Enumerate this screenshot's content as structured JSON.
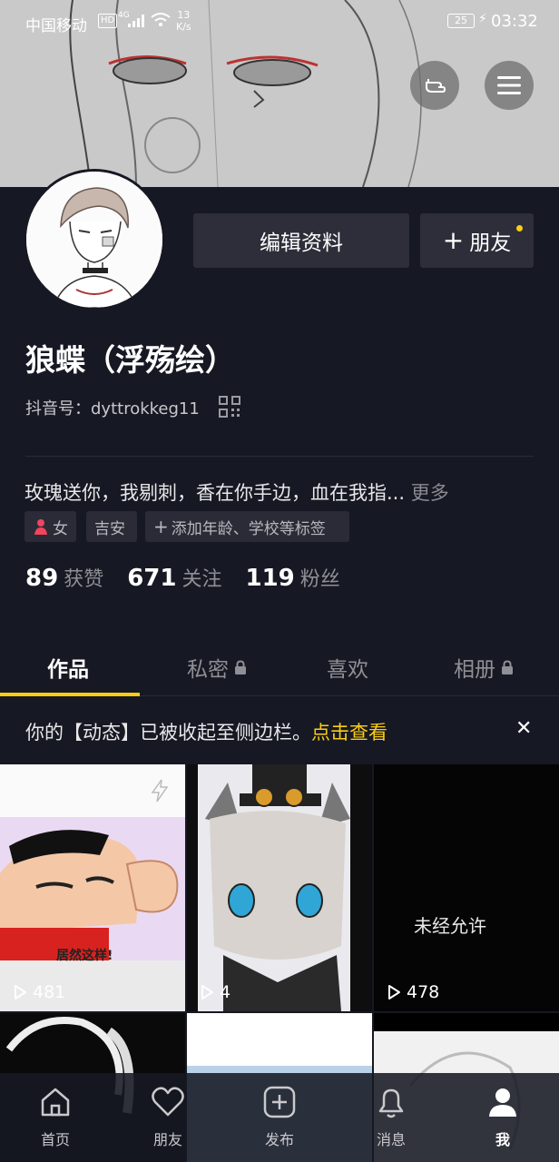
{
  "status_bar": {
    "carrier": "中国移动",
    "hd": "HD",
    "network": "4G",
    "speed_value": "13",
    "speed_unit": "K/s",
    "battery": "25",
    "time": "03:32"
  },
  "profile": {
    "edit_button": "编辑资料",
    "friend_button": "朋友",
    "nickname": "狼蝶（浮殇绘）",
    "douyin_id": "抖音号：dyttrokkeg11",
    "bio": "玫瑰送你，我剔刺，香在你手边，血在我指...",
    "bio_more": "更多",
    "tags": {
      "gender": "女",
      "city": "吉安",
      "add": "添加年龄、学校等标签"
    },
    "stats": [
      {
        "num": "89",
        "label": "获赞"
      },
      {
        "num": "671",
        "label": "关注"
      },
      {
        "num": "119",
        "label": "粉丝"
      }
    ]
  },
  "tabs": [
    {
      "label": "作品",
      "active": true
    },
    {
      "label": "私密",
      "locked": true
    },
    {
      "label": "喜欢"
    },
    {
      "label": "相册",
      "locked": true
    }
  ],
  "notice": {
    "text": "你的【动态】已被收起至侧边栏。",
    "link": "点击查看",
    "close": "✕"
  },
  "videos": [
    {
      "plays": "481",
      "caption": "居然这样!"
    },
    {
      "plays": "4"
    },
    {
      "plays": "478",
      "caption": "未经允许"
    }
  ],
  "bottom_nav": [
    {
      "label": "首页"
    },
    {
      "label": "朋友"
    },
    {
      "label": "发布"
    },
    {
      "label": "消息"
    },
    {
      "label": "我",
      "active": true
    }
  ],
  "colors": {
    "background": "#161823",
    "accent": "#face15",
    "button_bg": "#2d2e39"
  }
}
